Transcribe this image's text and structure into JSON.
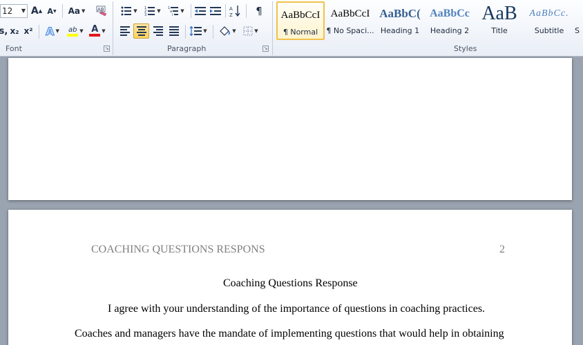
{
  "ribbon": {
    "font_group": {
      "label": "Font",
      "font_size": "12",
      "grow_font": "A",
      "shrink_font": "A",
      "change_case": "Aa",
      "subscript": "x₂",
      "superscript": "x²",
      "text_effects": "A",
      "highlight": "ab",
      "font_color": "A",
      "strike_partial": "s,"
    },
    "paragraph_group": {
      "label": "Paragraph",
      "pilcrow": "¶",
      "sort": "A↓Z"
    },
    "styles_group": {
      "label": "Styles",
      "items": [
        {
          "sample": "AaBbCcI",
          "name": "¶ Normal",
          "selected": true
        },
        {
          "sample": "AaBbCcI",
          "name": "¶ No Spaci..."
        },
        {
          "sample": "AaBbC(",
          "name": "Heading 1"
        },
        {
          "sample": "AaBbCc",
          "name": "Heading 2"
        },
        {
          "sample": "AaB",
          "name": "Title"
        },
        {
          "sample": "AaBbCc.",
          "name": "Subtitle"
        },
        {
          "sample": "",
          "name": "S"
        }
      ]
    },
    "colors": {
      "highlight": "#ffff00",
      "font_color": "#e01818",
      "heading_blue": "#365f91",
      "heading2_blue": "#4f81bd",
      "title_navy": "#17365d"
    }
  },
  "document": {
    "page2": {
      "running_head": "COACHING QUESTIONS RESPONS",
      "page_number": "2",
      "title": "Coaching Questions Response",
      "paragraph1": "I agree with your understanding of the importance of questions in coaching practices.",
      "paragraph2_line1": "Coaches and managers have the mandate of implementing questions that would help in obtaining"
    }
  }
}
